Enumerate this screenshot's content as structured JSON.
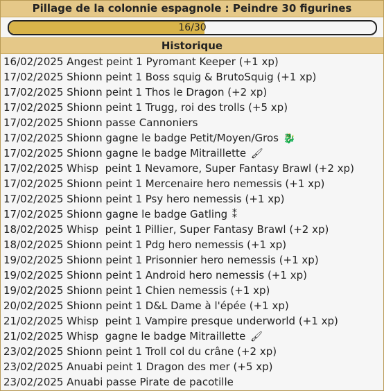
{
  "title": "Pillage de la colonnie espagnole : Peindre 30 figurines",
  "progress": {
    "current": 16,
    "total": 30,
    "label": "16/30",
    "fraction": 0.5333
  },
  "section_title": "Historique",
  "history": [
    {
      "text": "16/02/2025 Angest peint 1 Pyromant Keeper (+1 xp)",
      "icon": ""
    },
    {
      "text": "17/02/2025 Shionn peint 1 Boss squig & BrutoSquig (+1 xp)",
      "icon": ""
    },
    {
      "text": "17/02/2025 Shionn peint 1 Thos le Dragon (+2 xp)",
      "icon": ""
    },
    {
      "text": "17/02/2025 Shionn peint 1 Trugg, roi des trolls (+5 xp)",
      "icon": ""
    },
    {
      "text": "17/02/2025 Shionn passe Cannoniers",
      "icon": ""
    },
    {
      "text": "17/02/2025 Shionn gagne le badge Petit/Moyen/Gros",
      "icon": "🐉"
    },
    {
      "text": "17/02/2025 Shionn gagne le badge Mitraillette",
      "icon": "🖌"
    },
    {
      "text": "17/02/2025 Whisp  peint 1 Nevamore, Super Fantasy Brawl (+2 xp)",
      "icon": ""
    },
    {
      "text": "17/02/2025 Shionn peint 1 Mercenaire hero nemessis (+1 xp)",
      "icon": ""
    },
    {
      "text": "17/02/2025 Shionn peint 1 Psy hero nemessis (+1 xp)",
      "icon": ""
    },
    {
      "text": "17/02/2025 Shionn gagne le badge Gatling",
      "icon": "⁑"
    },
    {
      "text": "18/02/2025 Whisp  peint 1 Pillier, Super Fantasy Brawl (+2 xp)",
      "icon": ""
    },
    {
      "text": "18/02/2025 Shionn peint 1 Pdg hero nemessis (+1 xp)",
      "icon": ""
    },
    {
      "text": "19/02/2025 Shionn peint 1 Prisonnier hero nemessis (+1 xp)",
      "icon": ""
    },
    {
      "text": "19/02/2025 Shionn peint 1 Android hero nemessis (+1 xp)",
      "icon": ""
    },
    {
      "text": "19/02/2025 Shionn peint 1 Chien nemessis (+1 xp)",
      "icon": ""
    },
    {
      "text": "20/02/2025 Shionn peint 1 D&L Dame à l'épée (+1 xp)",
      "icon": ""
    },
    {
      "text": "21/02/2025 Whisp  peint 1 Vampire presque underworld (+1 xp)",
      "icon": ""
    },
    {
      "text": "21/02/2025 Whisp  gagne le badge Mitraillette",
      "icon": "🖌"
    },
    {
      "text": "23/02/2025 Shionn peint 1 Troll col du crâne (+2 xp)",
      "icon": ""
    },
    {
      "text": "23/02/2025 Anuabi peint 1 Dragon des mer (+5 xp)",
      "icon": ""
    },
    {
      "text": "23/02/2025 Anuabi passe Pirate de pacotille",
      "icon": ""
    }
  ],
  "icon_names": {
    "🐉": "dragon-badge-icon",
    "🖌": "brush-badge-icon",
    "⁑": "gatling-badge-icon"
  },
  "colors": {
    "header": "#e5c888",
    "progress_fill": "#d9b44a",
    "border": "#b89a55"
  }
}
